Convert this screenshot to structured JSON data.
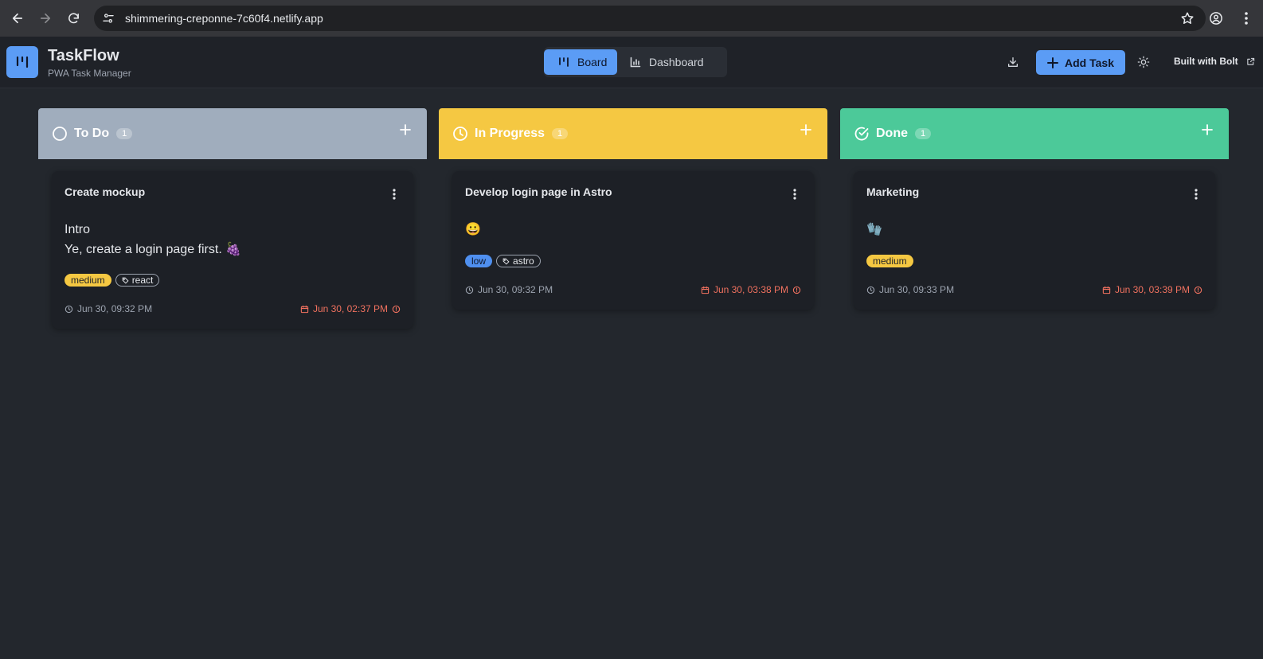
{
  "browser": {
    "url": "shimmering-creponne-7c60f4.netlify.app"
  },
  "app": {
    "title": "TaskFlow",
    "subtitle": "PWA Task Manager",
    "views": [
      {
        "label": "Board",
        "active": true
      },
      {
        "label": "Dashboard",
        "active": false
      }
    ],
    "add_task_label": "Add Task",
    "built_with_label": "Built with Bolt"
  },
  "colors": {
    "accent": "#5b9cf5",
    "todo": "#a0adbd",
    "in_progress": "#f5c842",
    "done": "#4cc999",
    "overdue": "#f0715f"
  },
  "columns": [
    {
      "title": "To Do",
      "count": "1",
      "cards": [
        {
          "title": "Create mockup",
          "description_lines": [
            "Intro",
            "Ye, create a login page first. 🍇"
          ],
          "priority": "medium",
          "tags": [
            "react"
          ],
          "created": "Jun 30, 09:32 PM",
          "due": "Jun 30, 02:37 PM"
        }
      ]
    },
    {
      "title": "In Progress",
      "count": "1",
      "cards": [
        {
          "title": "Develop login page in Astro",
          "description_lines": [
            "😀"
          ],
          "priority": "low",
          "tags": [
            "astro"
          ],
          "created": "Jun 30, 09:32 PM",
          "due": "Jun 30, 03:38 PM"
        }
      ]
    },
    {
      "title": "Done",
      "count": "1",
      "cards": [
        {
          "title": "Marketing",
          "description_lines": [
            "🧤"
          ],
          "priority": "medium",
          "tags": [],
          "created": "Jun 30, 09:33 PM",
          "due": "Jun 30, 03:39 PM"
        }
      ]
    }
  ]
}
